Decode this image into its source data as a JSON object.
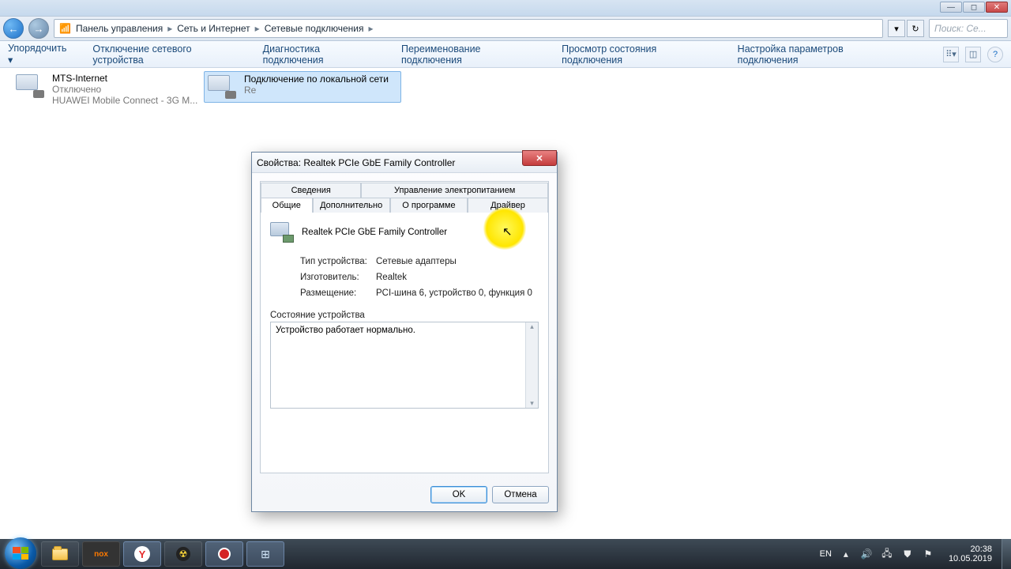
{
  "window_controls": {
    "min": "—",
    "max": "◻",
    "close": "✕"
  },
  "breadcrumb": {
    "c1": "Панель управления",
    "c2": "Сеть и Интернет",
    "c3": "Сетевые подключения"
  },
  "addr": {
    "dropdown": "▾",
    "refresh": "↻"
  },
  "search": {
    "placeholder": "Поиск: Се..."
  },
  "toolbar": {
    "organize": "Упорядочить ▾",
    "t1": "Отключение сетевого устройства",
    "t2": "Диагностика подключения",
    "t3": "Переименование подключения",
    "t4": "Просмотр состояния подключения",
    "t5": "Настройка параметров подключения"
  },
  "connections": {
    "a": {
      "name": "MTS-Internet",
      "status": "Отключено",
      "dev": "HUAWEI Mobile Connect - 3G M..."
    },
    "b": {
      "name": "Подключение по локальной сети",
      "status": "",
      "dev": "Re"
    }
  },
  "dialog": {
    "title": "Свойства: Realtek PCIe GbE Family Controller",
    "tabs": {
      "row1a": "Сведения",
      "row1b": "Управление электропитанием",
      "row2a": "Общие",
      "row2b": "Дополнительно",
      "row2c": "О программе",
      "row2d": "Драйвер"
    },
    "device_name": "Realtek PCIe GbE Family Controller",
    "k1": "Тип устройства:",
    "v1": "Сетевые адаптеры",
    "k2": "Изготовитель:",
    "v2": "Realtek",
    "k3": "Размещение:",
    "v3": "PCI-шина 6, устройство 0, функция 0",
    "group": "Состояние устройства",
    "status_text": "Устройство работает нормально.",
    "ok": "OK",
    "cancel": "Отмена",
    "close": "✕"
  },
  "tray": {
    "lang": "EN",
    "time": "20:38",
    "date": "10.05.2019"
  }
}
